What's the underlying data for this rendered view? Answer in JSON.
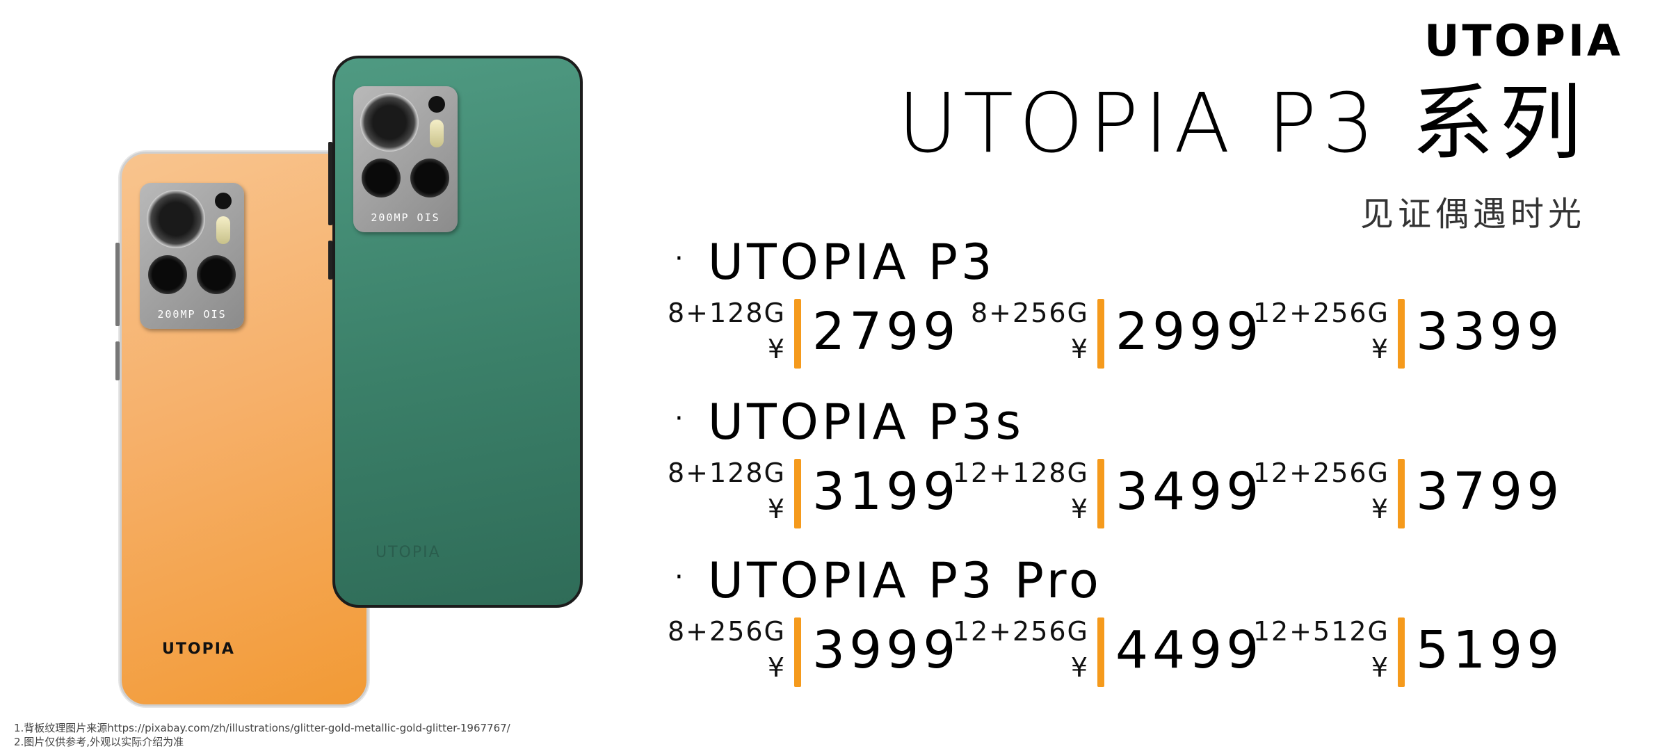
{
  "brand": "UTOPIA",
  "title": "UTOPIA P3 系列",
  "subtitle": "见证偶遇时光",
  "currency_symbol": "¥",
  "colors": {
    "accent_bar": "#f59a1c",
    "phone_orange": "#f6b06a",
    "phone_green": "#3b8069"
  },
  "phones": {
    "orange": {
      "logo": "UTOPIA",
      "camera_text": "200MP OIS"
    },
    "green": {
      "logo": "UTOPIA",
      "camera_text": "200MP OIS"
    }
  },
  "series": [
    {
      "name": "UTOPIA P3",
      "models": [
        {
          "spec": "8+128G",
          "price": "2799"
        },
        {
          "spec": "8+256G",
          "price": "2999"
        },
        {
          "spec": "12+256G",
          "price": "3399"
        }
      ]
    },
    {
      "name": "UTOPIA P3s",
      "models": [
        {
          "spec": "8+128G",
          "price": "3199"
        },
        {
          "spec": "12+128G",
          "price": "3499"
        },
        {
          "spec": "12+256G",
          "price": "3799"
        }
      ]
    },
    {
      "name": "UTOPIA P3 Pro",
      "models": [
        {
          "spec": "8+256G",
          "price": "3999"
        },
        {
          "spec": "12+256G",
          "price": "4499"
        },
        {
          "spec": "12+512G",
          "price": "5199"
        }
      ]
    }
  ],
  "footnotes": [
    "1.背板纹理图片来源https://pixabay.com/zh/illustrations/glitter-gold-metallic-gold-glitter-1967767/",
    "2.图片仅供参考,外观以实际介绍为准"
  ]
}
